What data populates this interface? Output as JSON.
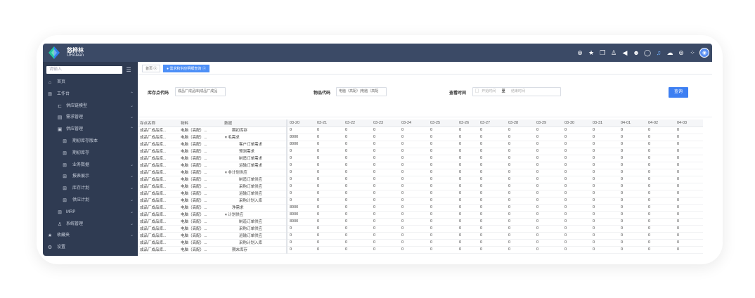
{
  "brand": {
    "name_cn": "悠桦林",
    "name_en": "UHAlean"
  },
  "header_icons": [
    "plus-icon",
    "star-icon",
    "copy-icon",
    "user-icon",
    "volume-icon",
    "emoji-icon",
    "chat-icon",
    "bell-icon",
    "cloud-icon",
    "globe-icon",
    "grid-icon",
    "avatar"
  ],
  "sidebar": {
    "search_placeholder": "请输入",
    "items": [
      {
        "name": "home",
        "icon": "home-icon",
        "label": "首页",
        "level": 0,
        "arrow": ""
      },
      {
        "name": "workbench",
        "icon": "grid-icon",
        "label": "工作台",
        "level": 0,
        "arrow": "⌃"
      },
      {
        "name": "supply-chain-model",
        "icon": "tree-icon",
        "label": "供应链模型",
        "level": 1,
        "arrow": "⌄"
      },
      {
        "name": "demand-management",
        "icon": "doc-icon",
        "label": "需求管理",
        "level": 1,
        "arrow": "⌄"
      },
      {
        "name": "supply-management",
        "icon": "box-icon",
        "label": "供应管理",
        "level": 1,
        "arrow": "⌃"
      },
      {
        "name": "opening-stock-version",
        "icon": "grid-icon",
        "label": "期初库存版本",
        "level": 2,
        "arrow": ""
      },
      {
        "name": "opening-stock",
        "icon": "grid-icon",
        "label": "期初库存",
        "level": 2,
        "arrow": ""
      },
      {
        "name": "business-data",
        "icon": "grid-icon",
        "label": "业务数据",
        "level": 2,
        "arrow": "⌄"
      },
      {
        "name": "report-display",
        "icon": "grid-icon",
        "label": "报表展示",
        "level": 2,
        "arrow": "⌄"
      },
      {
        "name": "inventory-plan",
        "icon": "grid-icon",
        "label": "库存计划",
        "level": 2,
        "arrow": "⌄"
      },
      {
        "name": "supply-plan",
        "icon": "grid-icon",
        "label": "供应计划",
        "level": 2,
        "arrow": "⌄"
      },
      {
        "name": "mrp",
        "icon": "grid-icon",
        "label": "MRP",
        "level": 1,
        "arrow": "⌄"
      },
      {
        "name": "system-management",
        "icon": "user-icon",
        "label": "系统管理",
        "level": 1,
        "arrow": "⌄"
      },
      {
        "name": "favorites",
        "icon": "star-icon",
        "label": "收藏夹",
        "level": 0,
        "arrow": "⌄"
      },
      {
        "name": "settings",
        "icon": "gear-icon",
        "label": "设置",
        "level": 0,
        "arrow": ""
      }
    ]
  },
  "tabs": [
    {
      "label": "首页",
      "active": false
    },
    {
      "label": "需求和供应明细查询",
      "active": true
    }
  ],
  "filters": {
    "stock_point_label": "库存点代码",
    "stock_point_value": "成品厂成品库|成品厂成品",
    "item_label": "物品代码",
    "item_value": "电脑（高配）|电脑（高配",
    "time_label": "查看时间",
    "start_placeholder": "开始时间",
    "separator": "至",
    "end_placeholder": "结束时间",
    "query_button": "查询"
  },
  "table": {
    "headers": [
      "存点名称",
      "物料",
      "数据",
      "03-20",
      "03-21",
      "03-22",
      "03-23",
      "03-24",
      "03-25",
      "03-26",
      "03-27",
      "03-28",
      "03-29",
      "03-30",
      "03-31",
      "04-01",
      "04-02",
      "04-03"
    ],
    "stock_point": "成品厂成品库...",
    "item": "电脑（高配）...",
    "rows": [
      {
        "data": "期初库存",
        "level": 1,
        "toggle": "",
        "first": "0"
      },
      {
        "data": "毛需求",
        "level": 0,
        "toggle": "▾",
        "first": "8000"
      },
      {
        "data": "客户订单需求",
        "level": 2,
        "toggle": "",
        "first": "8000"
      },
      {
        "data": "预测需求",
        "level": 2,
        "toggle": "",
        "first": "0"
      },
      {
        "data": "制造订单需求",
        "level": 2,
        "toggle": "",
        "first": "0"
      },
      {
        "data": "运输订单需求",
        "level": 2,
        "toggle": "",
        "first": "0"
      },
      {
        "data": "非计划供应",
        "level": 0,
        "toggle": "▾",
        "first": "0"
      },
      {
        "data": "制造订单供应",
        "level": 2,
        "toggle": "",
        "first": "0"
      },
      {
        "data": "采购订单供应",
        "level": 2,
        "toggle": "",
        "first": "0"
      },
      {
        "data": "运输订单供应",
        "level": 2,
        "toggle": "",
        "first": "0"
      },
      {
        "data": "采购计划入库",
        "level": 2,
        "toggle": "",
        "first": "0"
      },
      {
        "data": "净需求",
        "level": 1,
        "toggle": "",
        "first": "8000"
      },
      {
        "data": "计划供应",
        "level": 0,
        "toggle": "▾",
        "first": "8000"
      },
      {
        "data": "制造订单供应",
        "level": 2,
        "toggle": "",
        "first": "8000"
      },
      {
        "data": "采购订单供应",
        "level": 2,
        "toggle": "",
        "first": "0"
      },
      {
        "data": "运输订单供应",
        "level": 2,
        "toggle": "",
        "first": "0"
      },
      {
        "data": "采购计划入库",
        "level": 2,
        "toggle": "",
        "first": "0"
      },
      {
        "data": "期末库存",
        "level": 1,
        "toggle": "",
        "first": "0"
      }
    ],
    "other_value": "0"
  },
  "colors": {
    "header_bg": "#3b4a66",
    "sidebar_bg": "#2f3b52",
    "accent": "#3d7ff2"
  }
}
